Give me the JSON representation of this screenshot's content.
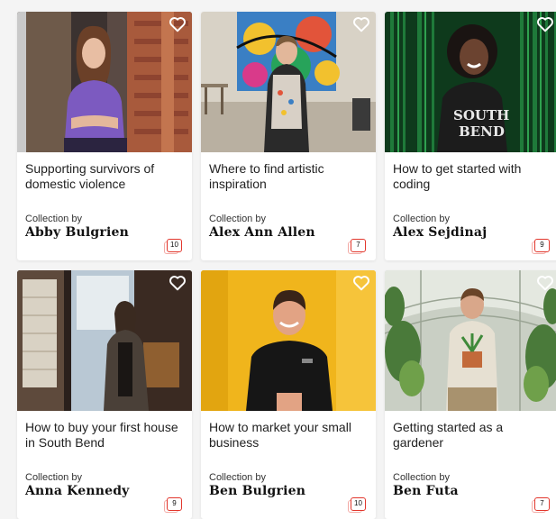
{
  "cards": [
    {
      "title": "Supporting survivors of domestic violence",
      "collection_label": "Collection by",
      "author": "Abby Bulgrien",
      "count": "10",
      "heart_icon": "heart-outline-icon"
    },
    {
      "title": "Where to find artistic inspiration",
      "collection_label": "Collection by",
      "author": "Alex Ann Allen",
      "count": "7",
      "heart_icon": "heart-outline-icon"
    },
    {
      "title": "How to get started with coding",
      "collection_label": "Collection by",
      "author": "Alex Sejdinaj",
      "count": "9",
      "heart_icon": "heart-outline-icon"
    },
    {
      "title": "How to buy your first house in South Bend",
      "collection_label": "Collection by",
      "author": "Anna Kennedy",
      "count": "9",
      "heart_icon": "heart-outline-icon"
    },
    {
      "title": "How to market your small business",
      "collection_label": "Collection by",
      "author": "Ben Bulgrien",
      "count": "10",
      "heart_icon": "heart-outline-icon"
    },
    {
      "title": "Getting started as a gardener",
      "collection_label": "Collection by",
      "author": "Ben Futa",
      "count": "7",
      "heart_icon": "heart-outline-icon"
    }
  ],
  "colors": {
    "accent": "#e2362c",
    "accent_light": "#f3a9a4",
    "text": "#222222"
  }
}
